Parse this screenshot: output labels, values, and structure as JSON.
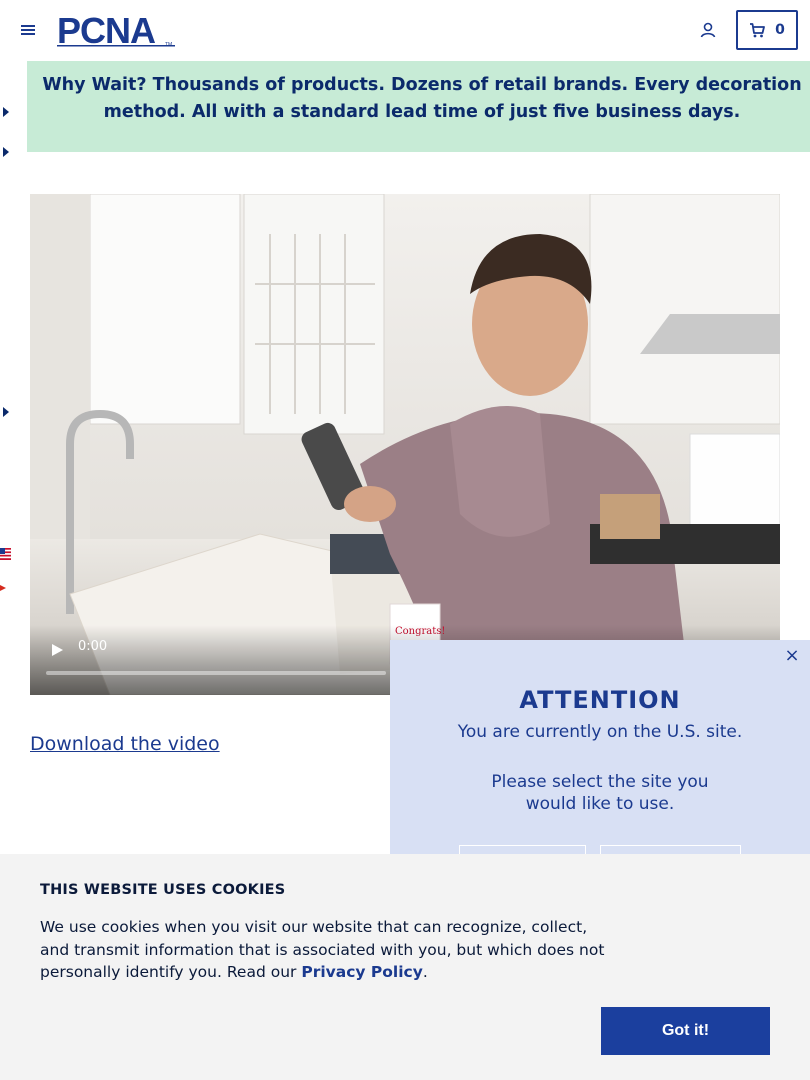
{
  "header": {
    "brand": "PCNA",
    "cart_count": "0"
  },
  "banner": {
    "lead": "Why Wait?",
    "text": " Thousands of products. Dozens of retail brands. Every decoration method. All with a standard lead time of just five business days."
  },
  "video": {
    "current_time": "0:00",
    "progress": 0
  },
  "download_link": "Download the video",
  "attention": {
    "close": "×",
    "title": "ATTENTION",
    "current_site": "You are currently on the U.S. site.",
    "prompt": "Please select the site you would like to use."
  },
  "cookie": {
    "title": "THIS WEBSITE USES COOKIES",
    "text": "We use cookies when you visit our website that can recognize, collect, and transmit information that is associated with you, but which does not personally identify you. Read our ",
    "link": "Privacy Policy",
    "text_end": ".",
    "button": "Got it!"
  },
  "colors": {
    "brand_blue": "#1b3a8f",
    "banner_green": "#c7ebd6",
    "modal_bg": "#d8e0f4",
    "button_blue": "#1b3f9e"
  }
}
